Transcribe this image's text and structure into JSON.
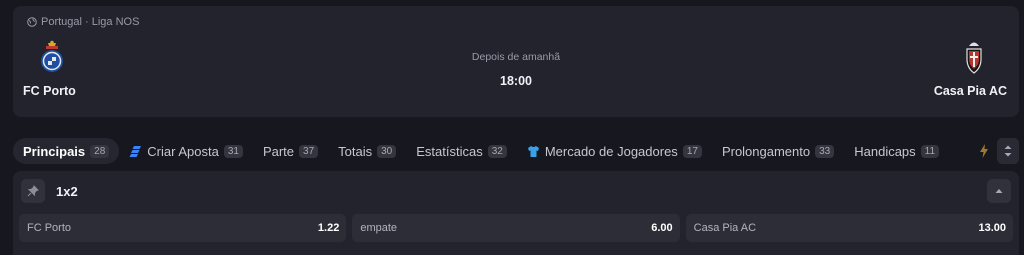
{
  "event": {
    "league": "Portugal · Liga NOS",
    "when_label": "Depois de amanhã",
    "time": "18:00",
    "home_team": "FC Porto",
    "away_team": "Casa Pia AC"
  },
  "tabs": [
    {
      "label": "Principais",
      "count": "28",
      "active": true
    },
    {
      "label": "Criar Aposta",
      "count": "31",
      "icon": "bet-builder-icon"
    },
    {
      "label": "Parte",
      "count": "37"
    },
    {
      "label": "Totais",
      "count": "30"
    },
    {
      "label": "Estatísticas",
      "count": "32"
    },
    {
      "label": "Mercado de Jogadores",
      "count": "17",
      "icon": "jersey-icon"
    },
    {
      "label": "Prolongamento",
      "count": "33"
    },
    {
      "label": "Handicaps",
      "count": "11"
    }
  ],
  "market": {
    "title": "1x2",
    "outcomes": [
      {
        "name": "FC Porto",
        "price": "1.22"
      },
      {
        "name": "empate",
        "price": "6.00"
      },
      {
        "name": "Casa Pia AC",
        "price": "13.00"
      }
    ]
  },
  "colors": {
    "background": "#17171f",
    "card": "#23232d",
    "accent_blue": "#3b82f6",
    "lightning_amber": "#a07a2a"
  }
}
